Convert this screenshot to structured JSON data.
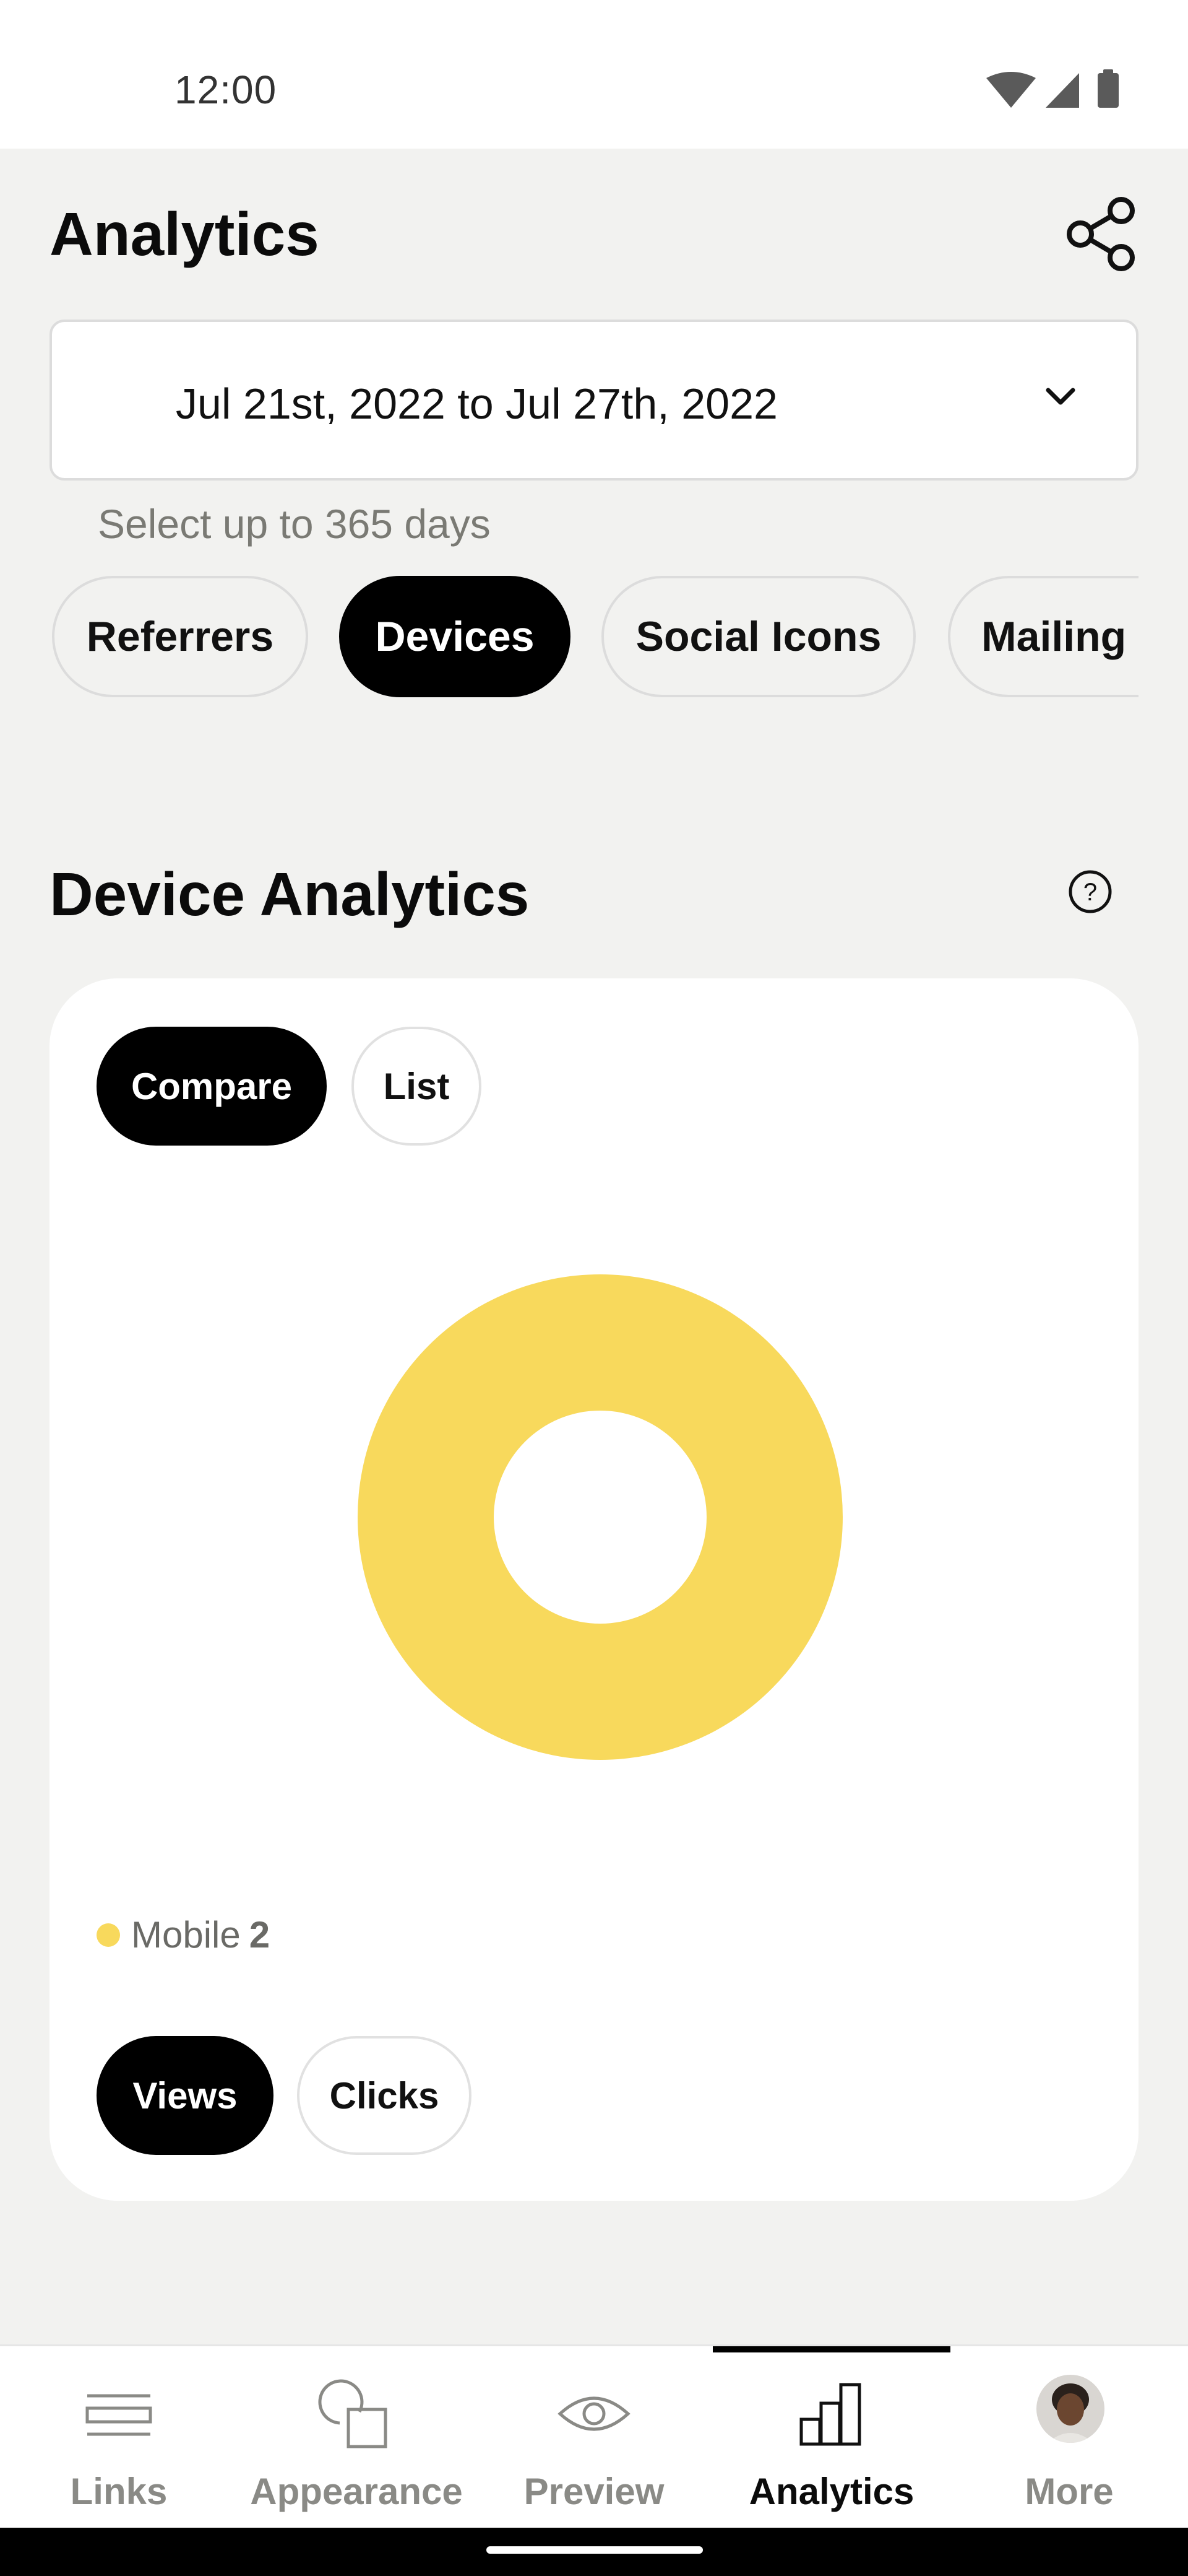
{
  "status_bar": {
    "time": "12:00"
  },
  "header": {
    "title": "Analytics",
    "share_icon": "share-icon"
  },
  "date_range": {
    "value": "Jul 21st, 2022 to Jul 27th, 2022",
    "hint": "Select up to 365 days"
  },
  "tabs": [
    {
      "label": "Referrers",
      "active": false
    },
    {
      "label": "Devices",
      "active": true
    },
    {
      "label": "Social Icons",
      "active": false
    },
    {
      "label": "Mailing",
      "active": false
    }
  ],
  "section": {
    "title": "Device Analytics",
    "help_icon": "help-icon"
  },
  "card": {
    "view_toggle": {
      "compare": "Compare",
      "list": "List",
      "selected": "Compare"
    },
    "metric_toggle": {
      "views": "Views",
      "clicks": "Clicks",
      "selected": "Views"
    }
  },
  "chart_data": {
    "type": "pie",
    "donut": true,
    "categories": [
      "Mobile"
    ],
    "values": [
      2
    ],
    "colors": [
      "#f8d95c"
    ],
    "legend": [
      {
        "name": "Mobile",
        "value": "2"
      }
    ]
  },
  "bottom_nav": {
    "items": [
      {
        "label": "Links",
        "icon": "links-icon"
      },
      {
        "label": "Appearance",
        "icon": "appearance-icon"
      },
      {
        "label": "Preview",
        "icon": "eye-icon"
      },
      {
        "label": "Analytics",
        "icon": "analytics-icon",
        "active": true
      },
      {
        "label": "More",
        "icon": "avatar"
      }
    ]
  },
  "colors": {
    "accent": "#000000",
    "background": "#f2f2f0",
    "chart_yellow": "#f8d95c"
  }
}
